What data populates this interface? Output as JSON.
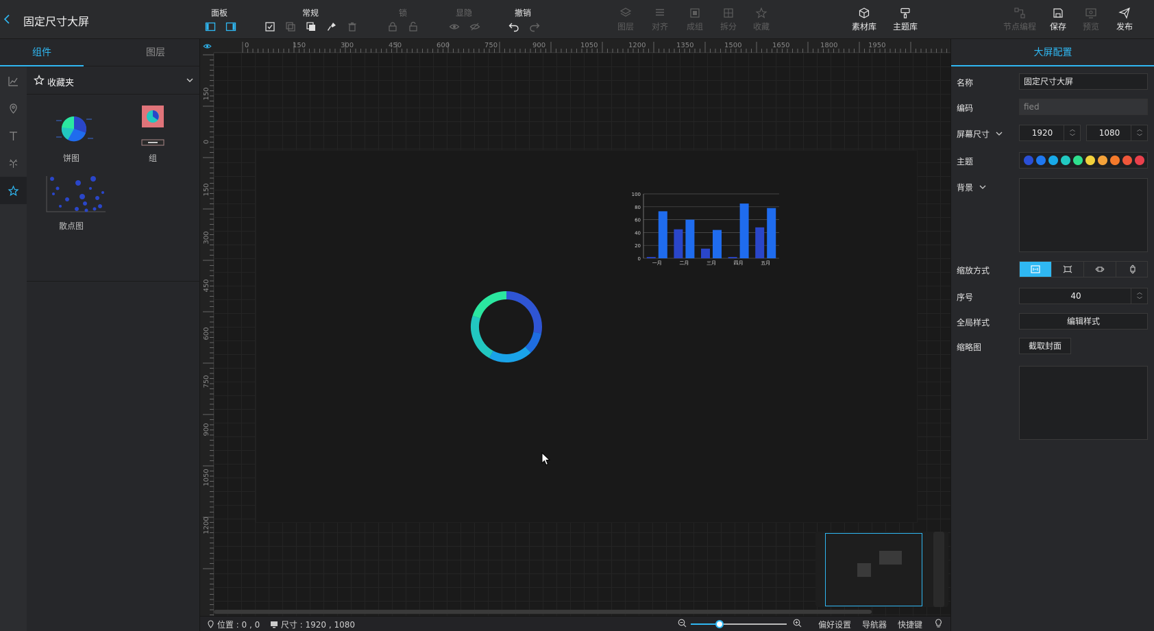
{
  "app": {
    "title": "固定尺寸大屏"
  },
  "toolbar": {
    "groups": {
      "panel": "面板",
      "general": "常规",
      "lock": "锁",
      "visibility": "显隐",
      "undo": "撤销"
    },
    "buttons": {
      "layer": "图层",
      "align": "对齐",
      "group": "成组",
      "split": "拆分",
      "collect": "收藏",
      "assets": "素材库",
      "themes": "主题库",
      "node_programming": "节点编程",
      "save": "保存",
      "preview": "预览",
      "publish": "发布"
    }
  },
  "left_panel": {
    "tabs": [
      "组件",
      "图层"
    ],
    "favorites_title": "收藏夹",
    "components": [
      {
        "label": "饼图"
      },
      {
        "label": "组"
      },
      {
        "label": "散点图"
      }
    ]
  },
  "rulers": {
    "h_ticks": [
      "0",
      "150",
      "300",
      "450",
      "600",
      "750",
      "900",
      "1050",
      "1200",
      "1350",
      "1500",
      "1650",
      "1800",
      "1950"
    ],
    "v_ticks": [
      "150",
      "0",
      "150",
      "300",
      "450",
      "600",
      "750",
      "900",
      "1050",
      "1200"
    ]
  },
  "canvas": {
    "donut_segments": [
      {
        "value": 28,
        "color": "#2f55d4"
      },
      {
        "value": 10,
        "color": "#1e6de0"
      },
      {
        "value": 20,
        "color": "#1aa3e8"
      },
      {
        "value": 22,
        "color": "#22c7c0"
      },
      {
        "value": 20,
        "color": "#2be7a0"
      }
    ],
    "bar_chart": {
      "type": "bar",
      "categories": [
        "一月",
        "二月",
        "三月",
        "四月",
        "五月"
      ],
      "series": [
        {
          "values": [
            2,
            45,
            15,
            2,
            48
          ],
          "color": "#2a46c9"
        },
        {
          "values": [
            73,
            60,
            44,
            85,
            78
          ],
          "color": "#1f6cee"
        }
      ],
      "ylim": [
        0,
        100
      ],
      "yticks": [
        "0",
        "20",
        "40",
        "60",
        "80",
        "100"
      ]
    }
  },
  "statusbar": {
    "position": "位置 : 0 , 0",
    "size": "尺寸 : 1920 , 1080",
    "preferences": "偏好设置",
    "navigator": "导航器",
    "shortcuts": "快捷键"
  },
  "right_panel": {
    "title": "大屏配置",
    "name_label": "名称",
    "name_value": "固定尺寸大屏",
    "code_label": "编码",
    "code_value": "fied",
    "size_label": "屏幕尺寸",
    "width": "1920",
    "height": "1080",
    "theme_label": "主题",
    "theme_colors": [
      "#2a4fd6",
      "#1f78f0",
      "#18a9e8",
      "#22c9c2",
      "#2fe08e",
      "#f2d13c",
      "#f4a23a",
      "#f47a2b",
      "#f0573a",
      "#e9404c"
    ],
    "background_label": "背景",
    "scale_label": "缩放方式",
    "order_label": "序号",
    "order_value": "40",
    "global_style_label": "全局样式",
    "edit_style_btn": "编辑样式",
    "thumbnail_label": "缩略图",
    "capture_cover_btn": "截取封面"
  }
}
